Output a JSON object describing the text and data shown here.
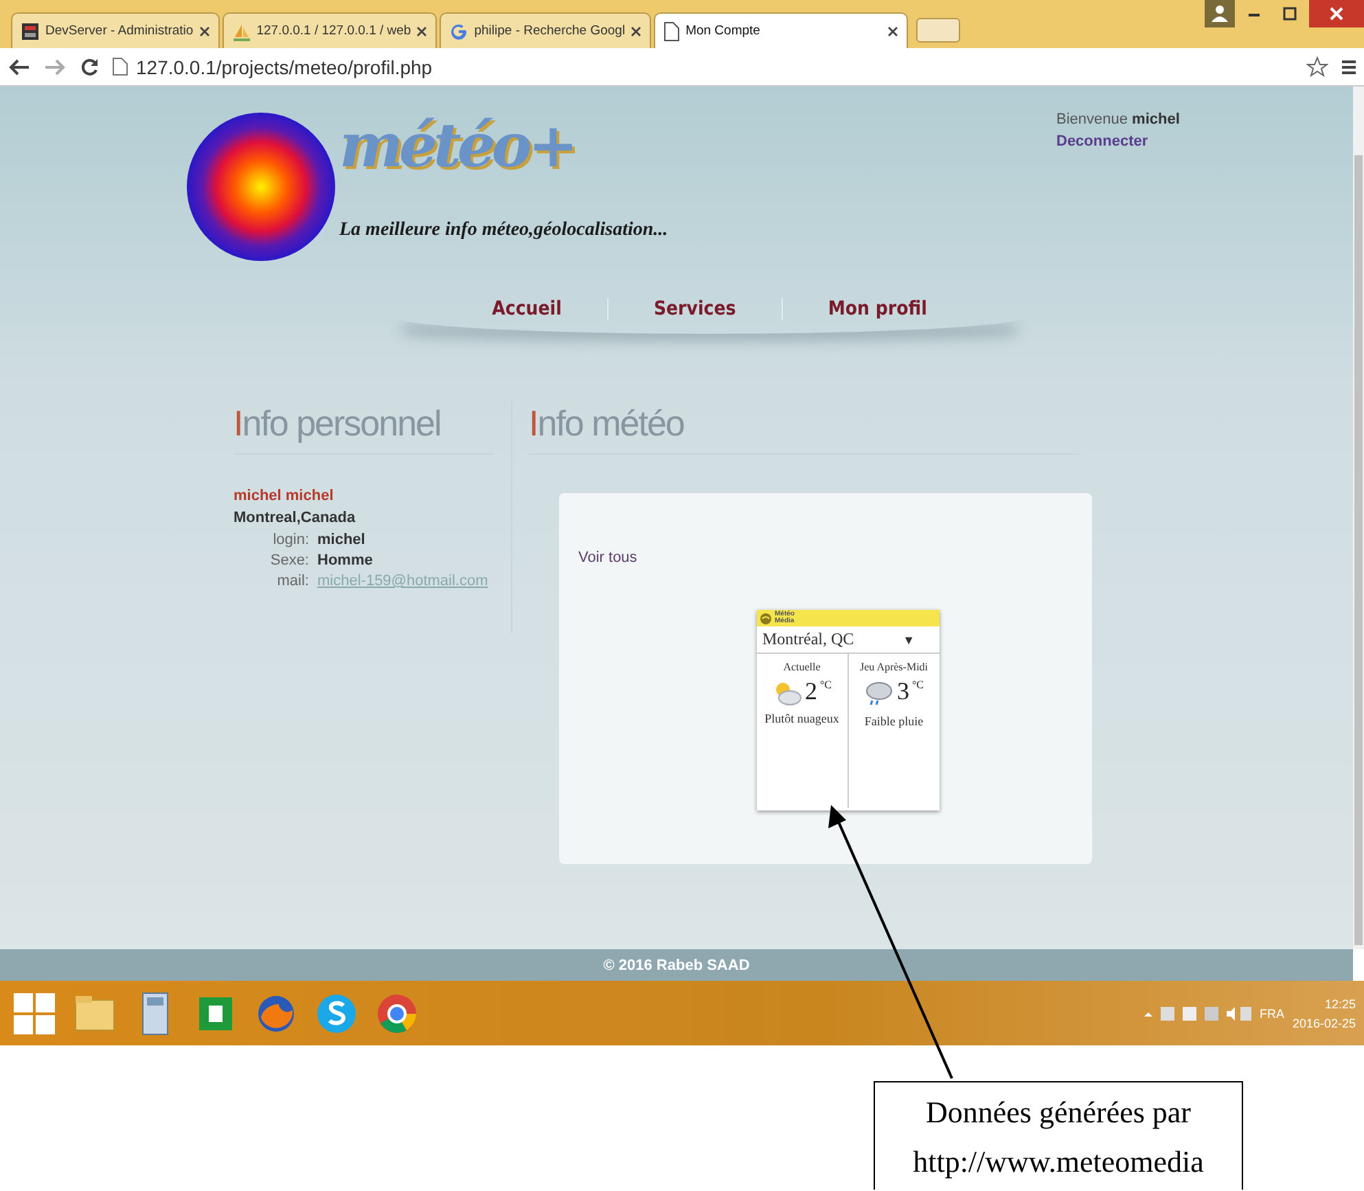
{
  "browser": {
    "tabs": [
      {
        "label": "DevServer - Administratio",
        "selected": false,
        "kind": "server"
      },
      {
        "label": "127.0.0.1 / 127.0.0.1 / web",
        "selected": false,
        "kind": "pma"
      },
      {
        "label": "philipe - Recherche Googl",
        "selected": false,
        "kind": "google"
      },
      {
        "label": "Mon Compte",
        "selected": true,
        "kind": "page"
      }
    ],
    "address": "127.0.0.1/projects/meteo/profil.php"
  },
  "site": {
    "logo": "météo+",
    "tagline": "La meilleure info méteo,géolocalisation...",
    "greeting": "Bienvenue **michel**",
    "logout": "Deconnecter",
    "nav": [
      "Accueil",
      "Services",
      "Mon profil"
    ]
  },
  "personal": {
    "title": "Info personnel",
    "name": "michel michel",
    "location": "Montreal,Canada",
    "fields": [
      {
        "label": "login:",
        "value": "michel",
        "kind": "text"
      },
      {
        "label": "Sexe:",
        "value": "Homme",
        "kind": "text"
      },
      {
        "label": "mail:",
        "value": "michel-159@hotmail.com",
        "kind": "link"
      }
    ]
  },
  "weather": {
    "title": "Info météo",
    "see_all": "Voir tous",
    "widget": {
      "brand": "Météo Média",
      "city": "Montréal, QC",
      "caret": "▼",
      "periods": [
        {
          "label": "Actuelle",
          "temp": "2",
          "unit": "°C",
          "condition": "Plutôt nuageux",
          "kind": "cloudy"
        },
        {
          "label": "Jeu Après-Midi",
          "temp": "3",
          "unit": "°C",
          "condition": "Faible pluie",
          "kind": "rain"
        }
      ]
    }
  },
  "footer": "© 2016 Rabeb SAAD",
  "taskbar": {
    "language": "FRA",
    "time": "12:25",
    "date": "2016-02-25"
  },
  "callout": "Données générées par http://www.meteomedia"
}
